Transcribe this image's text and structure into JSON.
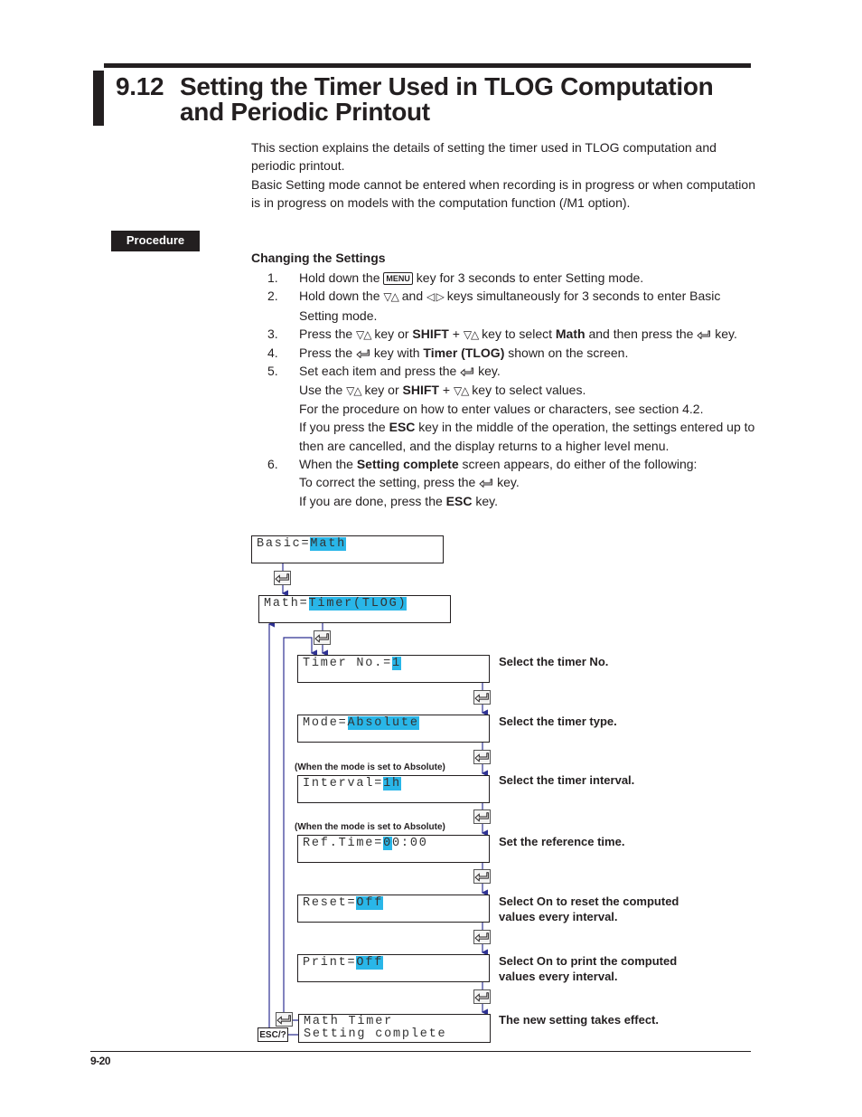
{
  "header": {
    "section_number": "9.12",
    "title_line1": "Setting the Timer Used in TLOG Computation",
    "title_line2": "and Periodic Printout"
  },
  "intro": {
    "p1": "This section explains the details of setting the timer used in TLOG computation and periodic printout.",
    "p2": "Basic Setting mode cannot be entered when recording is in progress or when computation is in progress on models with the computation function (/M1 option)."
  },
  "procedure_label": "Procedure",
  "steps_heading": "Changing the Settings",
  "keys": {
    "menu": "MENU",
    "updown": "▽△",
    "leftright": "◁ ▷",
    "enter_icon": "enter-key-icon"
  },
  "steps": [
    {
      "n": "1.",
      "a": "Hold down the ",
      "b": " key for 3 seconds to enter Setting mode."
    },
    {
      "n": "2.",
      "a": "Hold down the ",
      "b": " and ",
      "c": " keys simultaneously for 3 seconds to enter Basic Setting mode."
    },
    {
      "n": "3.",
      "a": "Press the ",
      "b": " key or ",
      "shift": "SHIFT",
      "c": " + ",
      "d": " key to select ",
      "math": "Math",
      "e": " and then press the ",
      "f": " key."
    },
    {
      "n": "4.",
      "a": "Press the ",
      "b": " key with ",
      "timer": "Timer (TLOG)",
      "c": " shown on the screen."
    },
    {
      "n": "5.",
      "a": "Set each item and press the ",
      "b": " key.",
      "l2a": "Use the ",
      "l2b": " key or ",
      "shift": "SHIFT",
      "l2c": " + ",
      "l2d": " key to select values.",
      "l3": "For the procedure on how to enter values or characters, see section 4.2.",
      "l4a": "If you press the ",
      "esc": "ESC",
      "l4b": " key in the middle of the operation, the settings entered up to then are cancelled, and the display returns to a higher level menu."
    },
    {
      "n": "6.",
      "a": "When the ",
      "sc": "Setting complete",
      "b": " screen appears, do either of the following:",
      "l2a": "To correct the setting, press the ",
      "l2b": " key.",
      "l3a": "If you are done, press the ",
      "esc": "ESC",
      "l3b": " key."
    }
  ],
  "flow": {
    "basic": {
      "label": "Basic=",
      "value": "Math"
    },
    "math": {
      "label": "Math=",
      "value": "Timer(TLOG)"
    },
    "timer_no": {
      "label": "Timer No.=",
      "value": "1",
      "desc": "Select the timer No."
    },
    "mode": {
      "label": "Mode=",
      "value": "Absolute",
      "desc": "Select the timer type."
    },
    "interval": {
      "cond": "(When the mode is set to Absolute)",
      "label": "Interval=",
      "value": "1h",
      "desc": "Select the timer interval."
    },
    "ref_time": {
      "cond": "(When the mode is set to Absolute)",
      "label": "Ref.Time=",
      "value": "0",
      "rest": "0:00",
      "desc": "Set the reference time."
    },
    "reset": {
      "label": "Reset=",
      "value": "Off",
      "desc": "Select On to reset the computed values every interval."
    },
    "print": {
      "label": "Print=",
      "value": "Off",
      "desc": "Select On to print the computed values every interval."
    },
    "complete": {
      "line1": "Math Timer",
      "line2": "Setting complete",
      "desc": "The new setting takes effect."
    },
    "esc_key": "ESC/?"
  },
  "footer": {
    "page": "9-20"
  },
  "colors": {
    "highlight": "#29b6e8",
    "arrow": "#2e3192",
    "text": "#231f20"
  }
}
